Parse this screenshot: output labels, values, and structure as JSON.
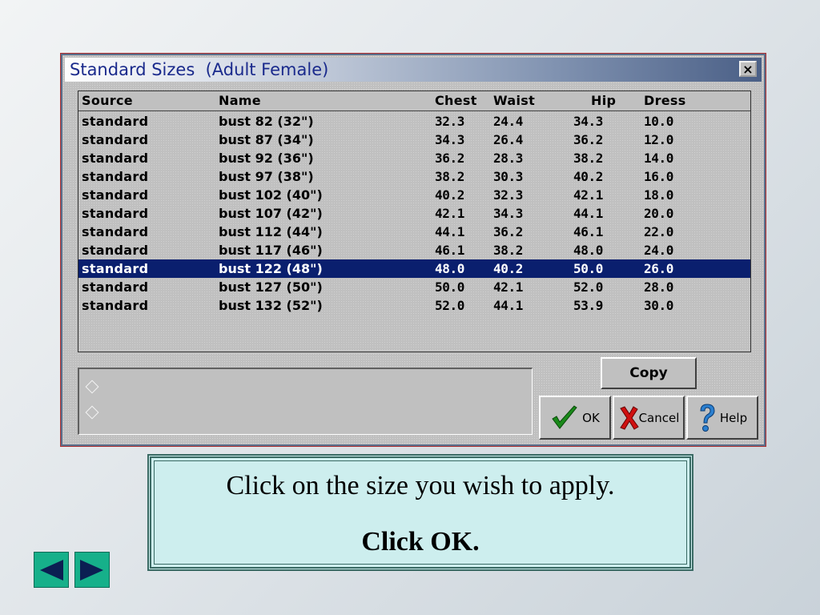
{
  "dialog": {
    "title": "Standard Sizes  (Adult Female)",
    "close_label": "×"
  },
  "table": {
    "columns": [
      "Source",
      "Name",
      "Chest",
      "Waist",
      "Hip",
      "Dress"
    ],
    "rows": [
      [
        "standard",
        "bust  82 (32\")",
        "32.3",
        "24.4",
        "34.3",
        "10.0"
      ],
      [
        "standard",
        "bust  87 (34\")",
        "34.3",
        "26.4",
        "36.2",
        "12.0"
      ],
      [
        "standard",
        "bust  92 (36\")",
        "36.2",
        "28.3",
        "38.2",
        "14.0"
      ],
      [
        "standard",
        "bust  97 (38\")",
        "38.2",
        "30.3",
        "40.2",
        "16.0"
      ],
      [
        "standard",
        "bust 102 (40\")",
        "40.2",
        "32.3",
        "42.1",
        "18.0"
      ],
      [
        "standard",
        "bust 107 (42\")",
        "42.1",
        "34.3",
        "44.1",
        "20.0"
      ],
      [
        "standard",
        "bust 112 (44\")",
        "44.1",
        "36.2",
        "46.1",
        "22.0"
      ],
      [
        "standard",
        "bust 117 (46\")",
        "46.1",
        "38.2",
        "48.0",
        "24.0"
      ],
      [
        "standard",
        "bust 122 (48\")",
        "48.0",
        "40.2",
        "50.0",
        "26.0"
      ],
      [
        "standard",
        "bust 127 (50\")",
        "50.0",
        "42.1",
        "52.0",
        "28.0"
      ],
      [
        "standard",
        "bust 132 (52\")",
        "52.0",
        "44.1",
        "53.9",
        "30.0"
      ]
    ],
    "selected_index": 8
  },
  "buttons": {
    "copy": "Copy",
    "ok": "OK",
    "cancel": "Cancel",
    "help": "Help"
  },
  "instruction": {
    "line1": "Click on the size you wish to apply.",
    "line2": "Click OK."
  },
  "icons": {
    "ok": "check-icon",
    "cancel": "x-icon",
    "help": "question-icon",
    "prev": "triangle-left-icon",
    "next": "triangle-right-icon"
  },
  "colors": {
    "selection": "#0a1f6e",
    "instruction_bg": "#cdeeee",
    "nav": "#16b08a"
  }
}
